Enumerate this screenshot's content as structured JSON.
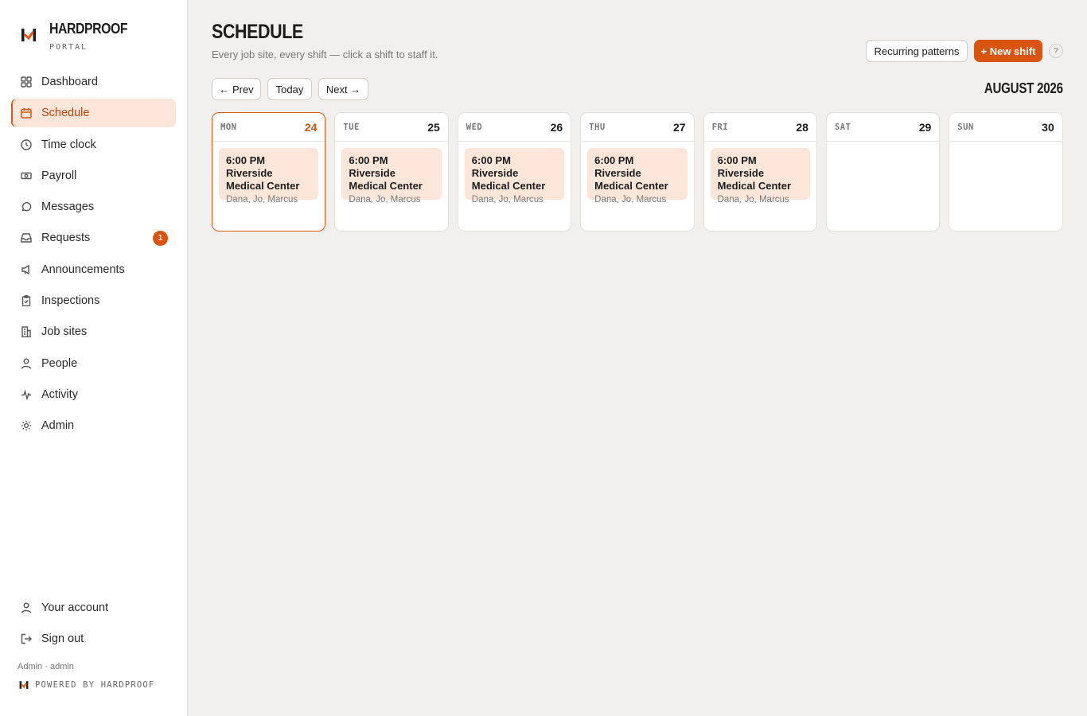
{
  "brand": {
    "name": "HARDPROOF",
    "sub": "PORTAL"
  },
  "sidebar": {
    "items": [
      {
        "label": "Dashboard",
        "icon": "grid-icon"
      },
      {
        "label": "Schedule",
        "icon": "calendar-icon",
        "active": true
      },
      {
        "label": "Time clock",
        "icon": "clock-icon"
      },
      {
        "label": "Payroll",
        "icon": "banknote-icon"
      },
      {
        "label": "Messages",
        "icon": "chat-bubble-icon"
      },
      {
        "label": "Requests",
        "icon": "inbox-icon",
        "badge": "1"
      },
      {
        "label": "Announcements",
        "icon": "megaphone-icon"
      },
      {
        "label": "Inspections",
        "icon": "clipboard-check-icon"
      },
      {
        "label": "Job sites",
        "icon": "building-icon"
      },
      {
        "label": "People",
        "icon": "person-icon"
      },
      {
        "label": "Activity",
        "icon": "activity-pulse-icon"
      },
      {
        "label": "Admin",
        "icon": "gear-icon"
      }
    ],
    "bottom": [
      {
        "label": "Your account",
        "icon": "person-icon"
      },
      {
        "label": "Sign out",
        "icon": "sign-out-icon"
      }
    ],
    "footer_meta": "Admin · admin",
    "powered_by": "POWERED BY HARDPROOF"
  },
  "header": {
    "title": "SCHEDULE",
    "subtitle": "Every job site, every shift — click a shift to staff it.",
    "recurring_label": "Recurring patterns",
    "new_shift_label": "+ New shift",
    "help_label": "?"
  },
  "nav": {
    "prev_label": "← Prev",
    "today_label": "Today",
    "next_label": "Next →",
    "month_label": "AUGUST 2026"
  },
  "days": [
    {
      "dow": "MON",
      "num": "24",
      "today": true,
      "shift": {
        "title": "6:00 PM Riverside Medical Center",
        "people": "Dana, Jo, Marcus"
      }
    },
    {
      "dow": "TUE",
      "num": "25",
      "shift": {
        "title": "6:00 PM Riverside Medical Center",
        "people": "Dana, Jo, Marcus"
      }
    },
    {
      "dow": "WED",
      "num": "26",
      "shift": {
        "title": "6:00 PM Riverside Medical Center",
        "people": "Dana, Jo, Marcus"
      }
    },
    {
      "dow": "THU",
      "num": "27",
      "shift": {
        "title": "6:00 PM Riverside Medical Center",
        "people": "Dana, Jo, Marcus"
      }
    },
    {
      "dow": "FRI",
      "num": "28",
      "shift": {
        "title": "6:00 PM Riverside Medical Center",
        "people": "Dana, Jo, Marcus"
      }
    },
    {
      "dow": "SAT",
      "num": "29",
      "shift": null
    },
    {
      "dow": "SUN",
      "num": "30",
      "shift": null
    }
  ],
  "colors": {
    "accent": "#d9540f",
    "accent_soft": "#fce6d9",
    "background": "#f1f0ee"
  }
}
